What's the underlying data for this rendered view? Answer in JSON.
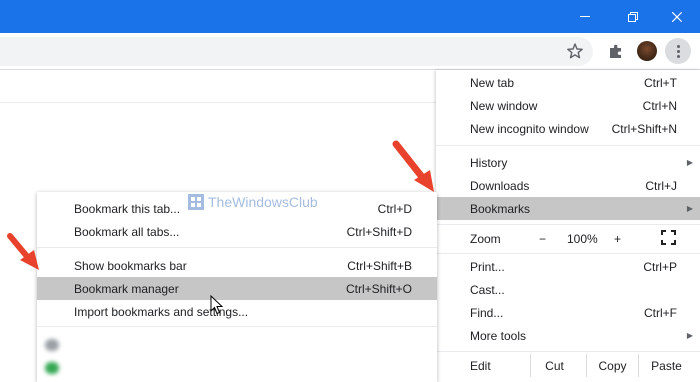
{
  "window": {
    "minimize_icon": "minimize-icon",
    "maximize_icon": "restore-icon",
    "close_icon": "close-icon"
  },
  "toolbar": {
    "star_icon": "star-icon",
    "extensions_icon": "puzzle-icon",
    "menu_icon": "kebab-menu-icon"
  },
  "main_menu": {
    "items": [
      {
        "label": "New tab",
        "shortcut": "Ctrl+T"
      },
      {
        "label": "New window",
        "shortcut": "Ctrl+N"
      },
      {
        "label": "New incognito window",
        "shortcut": "Ctrl+Shift+N"
      },
      {
        "label": "History",
        "shortcut": ""
      },
      {
        "label": "Downloads",
        "shortcut": "Ctrl+J"
      },
      {
        "label": "Bookmarks",
        "shortcut": ""
      },
      {
        "label": "Print...",
        "shortcut": "Ctrl+P"
      },
      {
        "label": "Cast...",
        "shortcut": ""
      },
      {
        "label": "Find...",
        "shortcut": "Ctrl+F"
      },
      {
        "label": "More tools",
        "shortcut": ""
      }
    ],
    "zoom": {
      "label": "Zoom",
      "minus": "−",
      "value": "100%",
      "plus": "+"
    },
    "edit": {
      "label": "Edit",
      "cut": "Cut",
      "copy": "Copy",
      "paste": "Paste"
    }
  },
  "bookmarks_submenu": {
    "items": [
      {
        "label": "Bookmark this tab...",
        "shortcut": "Ctrl+D"
      },
      {
        "label": "Bookmark all tabs...",
        "shortcut": "Ctrl+Shift+D"
      },
      {
        "label": "Show bookmarks bar",
        "shortcut": "Ctrl+Shift+B"
      },
      {
        "label": "Bookmark manager",
        "shortcut": "Ctrl+Shift+O"
      },
      {
        "label": "Import bookmarks and settings...",
        "shortcut": ""
      }
    ]
  },
  "watermark": {
    "text": "TheWindowsClub"
  },
  "colors": {
    "titlebar": "#1a73e8",
    "highlight": "#c6c6c6",
    "arrow": "#e8412c"
  }
}
